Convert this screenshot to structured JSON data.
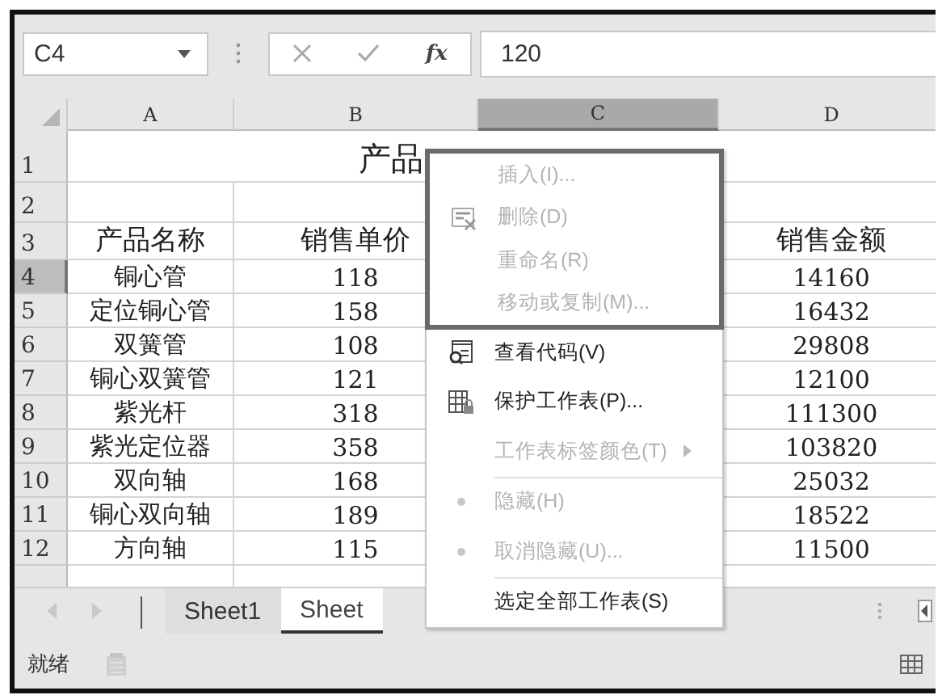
{
  "formula_bar": {
    "name_box": "C4",
    "function_label": "fx",
    "value": "120"
  },
  "columns": [
    {
      "label": "A",
      "selected": false
    },
    {
      "label": "B",
      "selected": false
    },
    {
      "label": "C",
      "selected": true
    },
    {
      "label": "D",
      "selected": false
    }
  ],
  "title_row": {
    "number": "1",
    "text": "产品"
  },
  "rows": [
    {
      "number": "2",
      "selected": false,
      "cells": [
        "",
        "",
        "",
        ""
      ]
    },
    {
      "number": "3",
      "selected": false,
      "cells": [
        "产品名称",
        "销售单价",
        "",
        "销售金额"
      ]
    },
    {
      "number": "4",
      "selected": true,
      "cells": [
        "铜心管",
        "118",
        "",
        "14160"
      ]
    },
    {
      "number": "5",
      "selected": false,
      "cells": [
        "定位铜心管",
        "158",
        "",
        "16432"
      ]
    },
    {
      "number": "6",
      "selected": false,
      "cells": [
        "双簧管",
        "108",
        "",
        "29808"
      ]
    },
    {
      "number": "7",
      "selected": false,
      "cells": [
        "铜心双簧管",
        "121",
        "",
        "12100"
      ]
    },
    {
      "number": "8",
      "selected": false,
      "cells": [
        "紫光杆",
        "318",
        "",
        "111300"
      ]
    },
    {
      "number": "9",
      "selected": false,
      "cells": [
        "紫光定位器",
        "358",
        "",
        "103820"
      ]
    },
    {
      "number": "10",
      "selected": false,
      "cells": [
        "双向轴",
        "168",
        "",
        "25032"
      ]
    },
    {
      "number": "11",
      "selected": false,
      "cells": [
        "铜心双向轴",
        "189",
        "",
        "18522"
      ]
    },
    {
      "number": "12",
      "selected": false,
      "cells": [
        "方向轴",
        "115",
        "",
        "11500"
      ]
    }
  ],
  "sheet_tabs": [
    {
      "label": "Sheet1",
      "selected": false
    },
    {
      "label": "Sheet",
      "selected": true
    }
  ],
  "status_bar": {
    "text": "就绪"
  },
  "context_menu": {
    "items": [
      {
        "label": "插入(I)...",
        "disabled": true,
        "kind": "plain",
        "highlighted": true
      },
      {
        "label": "删除(D)",
        "disabled": true,
        "kind": "delete",
        "highlighted": true
      },
      {
        "label": "重命名(R)",
        "disabled": true,
        "kind": "plain",
        "highlighted": true
      },
      {
        "label": "移动或复制(M)...",
        "disabled": true,
        "kind": "plain",
        "highlighted": true
      },
      {
        "label": "查看代码(V)",
        "disabled": false,
        "kind": "code",
        "highlighted": false
      },
      {
        "label": "保护工作表(P)...",
        "disabled": false,
        "kind": "protect",
        "highlighted": false
      },
      {
        "label": "工作表标签颜色(T)",
        "disabled": true,
        "kind": "plain",
        "highlighted": false,
        "submenu": true
      },
      {
        "label": "隐藏(H)",
        "disabled": true,
        "kind": "bullet",
        "highlighted": false,
        "separator_before": true
      },
      {
        "label": "取消隐藏(U)...",
        "disabled": true,
        "kind": "bullet",
        "highlighted": false
      },
      {
        "label": "选定全部工作表(S)",
        "disabled": false,
        "kind": "plain",
        "highlighted": false,
        "separator_before": true
      }
    ]
  }
}
